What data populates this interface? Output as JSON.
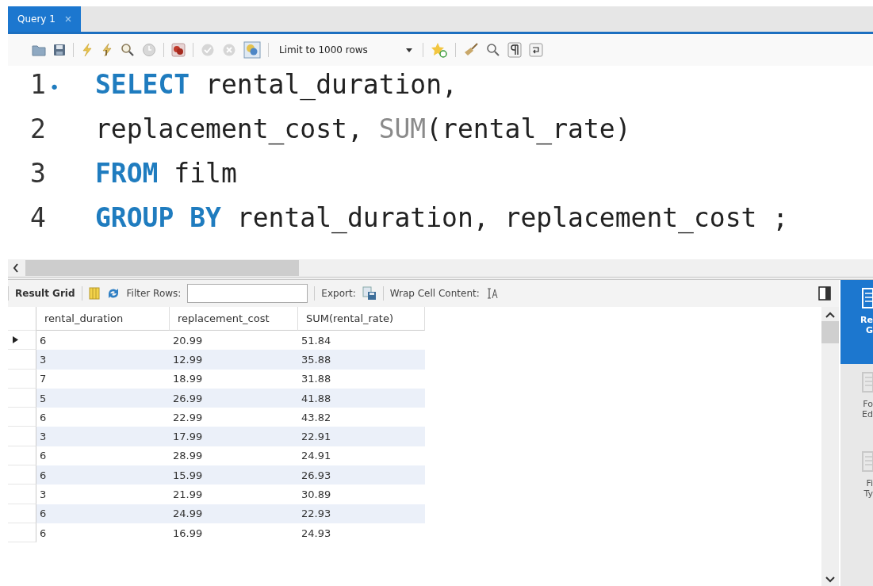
{
  "tabs": [
    {
      "label": "Query 1",
      "selected": true
    }
  ],
  "toolbar": {
    "limit": "Limit to 1000 rows"
  },
  "editor": {
    "lines": [
      {
        "number": "1",
        "marker": "•",
        "tokens": [
          {
            "kind": "keyword",
            "text": "SELECT"
          },
          {
            "kind": "plain",
            "text": " rental_duration,"
          }
        ]
      },
      {
        "number": "2",
        "tokens": [
          {
            "kind": "plain",
            "text": "replacement_cost, "
          },
          {
            "kind": "function",
            "text": "SUM"
          },
          {
            "kind": "plain",
            "text": "(rental_rate)"
          }
        ]
      },
      {
        "number": "3",
        "tokens": [
          {
            "kind": "keyword",
            "text": "FROM"
          },
          {
            "kind": "plain",
            "text": " film"
          }
        ]
      },
      {
        "number": "4",
        "tokens": [
          {
            "kind": "keyword",
            "text": "GROUP BY"
          },
          {
            "kind": "plain",
            "text": " rental_duration, replacement_cost ;"
          }
        ]
      }
    ]
  },
  "result_toolbar": {
    "result_grid": "Result Grid",
    "filter_label": "Filter Rows:",
    "export_label": "Export:",
    "wrap_label": "Wrap Cell Content:"
  },
  "table": {
    "columns": [
      "rental_duration",
      "replacement_cost",
      "SUM(rental_rate)"
    ],
    "rows": [
      {
        "current": true,
        "cells": [
          "6",
          "20.99",
          "51.84"
        ]
      },
      {
        "current": false,
        "cells": [
          "3",
          "12.99",
          "35.88"
        ]
      },
      {
        "current": false,
        "cells": [
          "7",
          "18.99",
          "31.88"
        ]
      },
      {
        "current": false,
        "cells": [
          "5",
          "26.99",
          "41.88"
        ]
      },
      {
        "current": false,
        "cells": [
          "6",
          "22.99",
          "43.82"
        ]
      },
      {
        "current": false,
        "cells": [
          "3",
          "17.99",
          "22.91"
        ]
      },
      {
        "current": false,
        "cells": [
          "6",
          "28.99",
          "24.91"
        ]
      },
      {
        "current": false,
        "cells": [
          "6",
          "15.99",
          "26.93"
        ]
      },
      {
        "current": false,
        "cells": [
          "3",
          "21.99",
          "30.89"
        ]
      },
      {
        "current": false,
        "cells": [
          "6",
          "24.99",
          "22.93"
        ]
      },
      {
        "current": false,
        "cells": [
          "6",
          "16.99",
          "24.93"
        ]
      }
    ]
  },
  "side_panel": [
    {
      "lines": [
        "Re",
        "G"
      ],
      "selected": true
    },
    {
      "lines": [
        "Fo",
        "Ed"
      ],
      "selected": false
    },
    {
      "lines": [
        "Fi",
        "Ty"
      ],
      "selected": false
    }
  ]
}
